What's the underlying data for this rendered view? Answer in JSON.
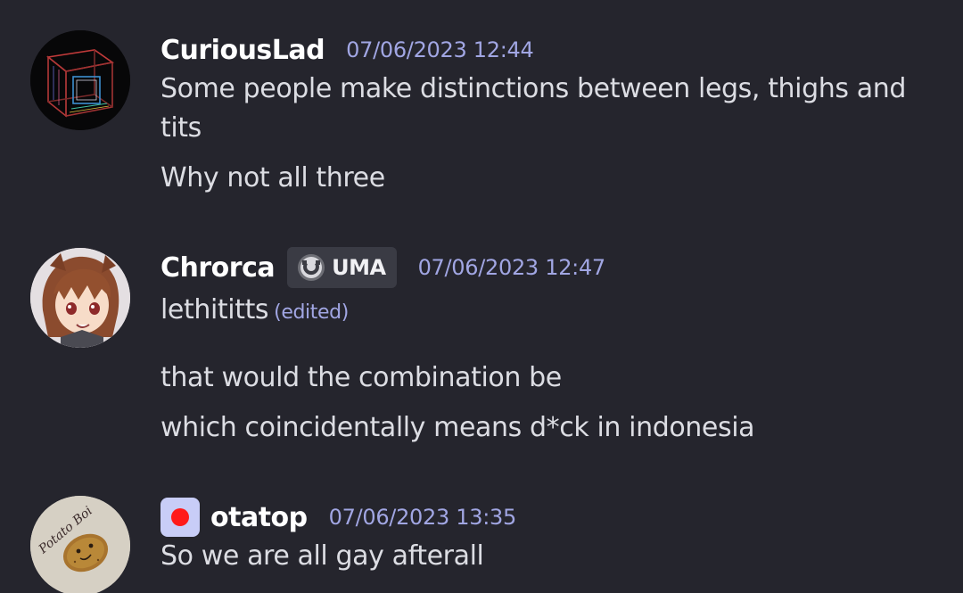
{
  "messages": [
    {
      "username": "CuriousLad",
      "timestamp": "07/06/2023 12:44",
      "avatar_icon": "monitor-wireframe-icon",
      "lines": [
        "Some people make distinctions between legs, thighs and",
        "tits",
        "Why not all three"
      ]
    },
    {
      "username": "Chrorca",
      "timestamp": "07/06/2023 12:47",
      "avatar_icon": "anime-girl-icon",
      "server_tag": "UMA",
      "server_tag_icon": "horseshoe-icon",
      "lines": [
        "lethititts",
        "that would the combination be",
        "which coincidentally means d*ck in indonesia"
      ],
      "edited_label": "(edited)"
    },
    {
      "username": "otatop",
      "timestamp": "07/06/2023 13:35",
      "avatar_icon": "potato-icon",
      "avatar_text": "Potato Boi",
      "app_icon": "red-dot-icon",
      "lines": [
        "So we are all gay afterall"
      ]
    }
  ],
  "colors": {
    "background": "#25252d",
    "username": "#ffffff",
    "message_text": "#dcdde3",
    "timestamp": "#a1a6e3",
    "tag_background": "#3a3b44",
    "app_icon_bg": "#c8cdf7",
    "app_icon_dot": "#ff1a1a"
  }
}
